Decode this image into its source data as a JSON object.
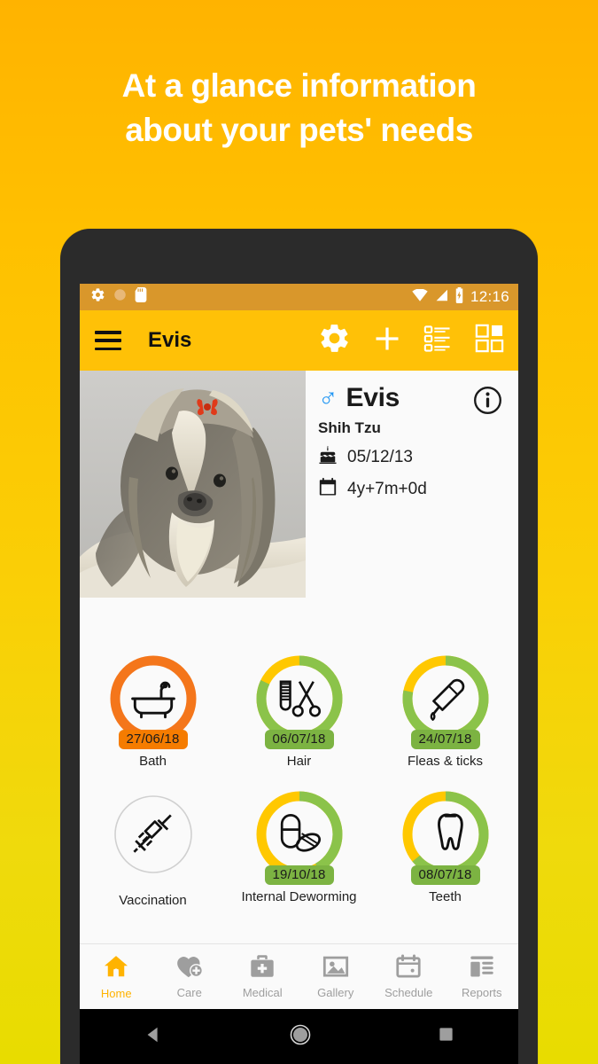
{
  "headline": {
    "line1": "At a glance information",
    "line2": "about your pets' needs"
  },
  "colors": {
    "bg_top": "#FFB300",
    "bg_bottom": "#E8DC00",
    "toolbar": "#FFC107",
    "statusbar": "#D9972B",
    "screen": "#FAFAFA",
    "orange": "#F57C00",
    "orange_ring": "#F4761B",
    "green": "#8BC34A",
    "green_badge": "#7CB342",
    "yellow": "#FFC800",
    "gray_ring": "#D0D0D0",
    "nav_active": "#FFB300",
    "nav_inactive": "#9E9E9E",
    "gender_blue": "#2196F3"
  },
  "statusbar": {
    "left_icons": [
      "gear-icon",
      "circle-icon",
      "sd-card-icon"
    ],
    "right_icons": [
      "wifi-icon",
      "signal-icon",
      "battery-charging-icon"
    ],
    "time": "12:16"
  },
  "toolbar": {
    "menu_icon": "hamburger-icon",
    "title": "Evis",
    "actions": [
      {
        "name": "settings-gear-button",
        "icon": "gear-icon"
      },
      {
        "name": "add-button",
        "icon": "plus-icon"
      },
      {
        "name": "list-view-button",
        "icon": "list-view-icon"
      },
      {
        "name": "grid-view-button",
        "icon": "grid-view-icon"
      }
    ]
  },
  "pet": {
    "photo_alt": "shih-tzu-photo",
    "gender_symbol": "♂",
    "name": "Evis",
    "breed": "Shih Tzu",
    "birthday_icon": "birthday-cake-icon",
    "birthday": "05/12/13",
    "age_icon": "calendar-icon",
    "age": "4y+7m+0d",
    "info_button_icon": "info-circle-icon"
  },
  "care_items": [
    {
      "id": "bath",
      "label": "Bath",
      "date": "27/06/18",
      "icon": "bathtub-icon",
      "ring_style": "full-orange",
      "ring_color": "#F4761B",
      "ring_secondary": "#F4761B",
      "badge_color": "#F57C00",
      "green_pct": 100
    },
    {
      "id": "hair",
      "label": "Hair",
      "date": "06/07/18",
      "icon": "comb-scissors-icon",
      "ring_style": "green-yellow",
      "ring_color": "#8BC34A",
      "ring_secondary": "#FFC800",
      "badge_color": "#7CB342",
      "green_pct": 82
    },
    {
      "id": "fleas-ticks",
      "label": "Fleas & ticks",
      "date": "24/07/18",
      "icon": "pipette-dropper-icon",
      "ring_style": "green-yellow",
      "ring_color": "#8BC34A",
      "ring_secondary": "#FFC800",
      "badge_color": "#7CB342",
      "green_pct": 78
    },
    {
      "id": "vaccination",
      "label": "Vaccination",
      "date": "",
      "icon": "syringe-icon",
      "ring_style": "empty-gray",
      "ring_color": "#D0D0D0",
      "ring_secondary": "#D0D0D0",
      "badge_color": "",
      "green_pct": 0
    },
    {
      "id": "internal-deworming",
      "label": "Internal Deworming",
      "date": "19/10/18",
      "icon": "pills-icon",
      "ring_style": "green-yellow",
      "ring_color": "#8BC34A",
      "ring_secondary": "#FFC800",
      "badge_color": "#7CB342",
      "green_pct": 42
    },
    {
      "id": "teeth",
      "label": "Teeth",
      "date": "08/07/18",
      "icon": "tooth-icon",
      "ring_style": "green-yellow",
      "ring_color": "#8BC34A",
      "ring_secondary": "#FFC800",
      "badge_color": "#7CB342",
      "green_pct": 64
    }
  ],
  "bottom_nav": [
    {
      "id": "home",
      "label": "Home",
      "icon": "house-icon",
      "active": true
    },
    {
      "id": "care",
      "label": "Care",
      "icon": "heart-plus-icon",
      "active": false
    },
    {
      "id": "medical",
      "label": "Medical",
      "icon": "medical-bag-icon",
      "active": false
    },
    {
      "id": "gallery",
      "label": "Gallery",
      "icon": "image-icon",
      "active": false
    },
    {
      "id": "schedule",
      "label": "Schedule",
      "icon": "calendar-icon",
      "active": false
    },
    {
      "id": "reports",
      "label": "Reports",
      "icon": "document-icon",
      "active": false
    }
  ],
  "android_nav": [
    {
      "id": "back",
      "icon": "back-triangle-icon"
    },
    {
      "id": "home",
      "icon": "home-circle-icon"
    },
    {
      "id": "recents",
      "icon": "recents-square-icon"
    }
  ]
}
